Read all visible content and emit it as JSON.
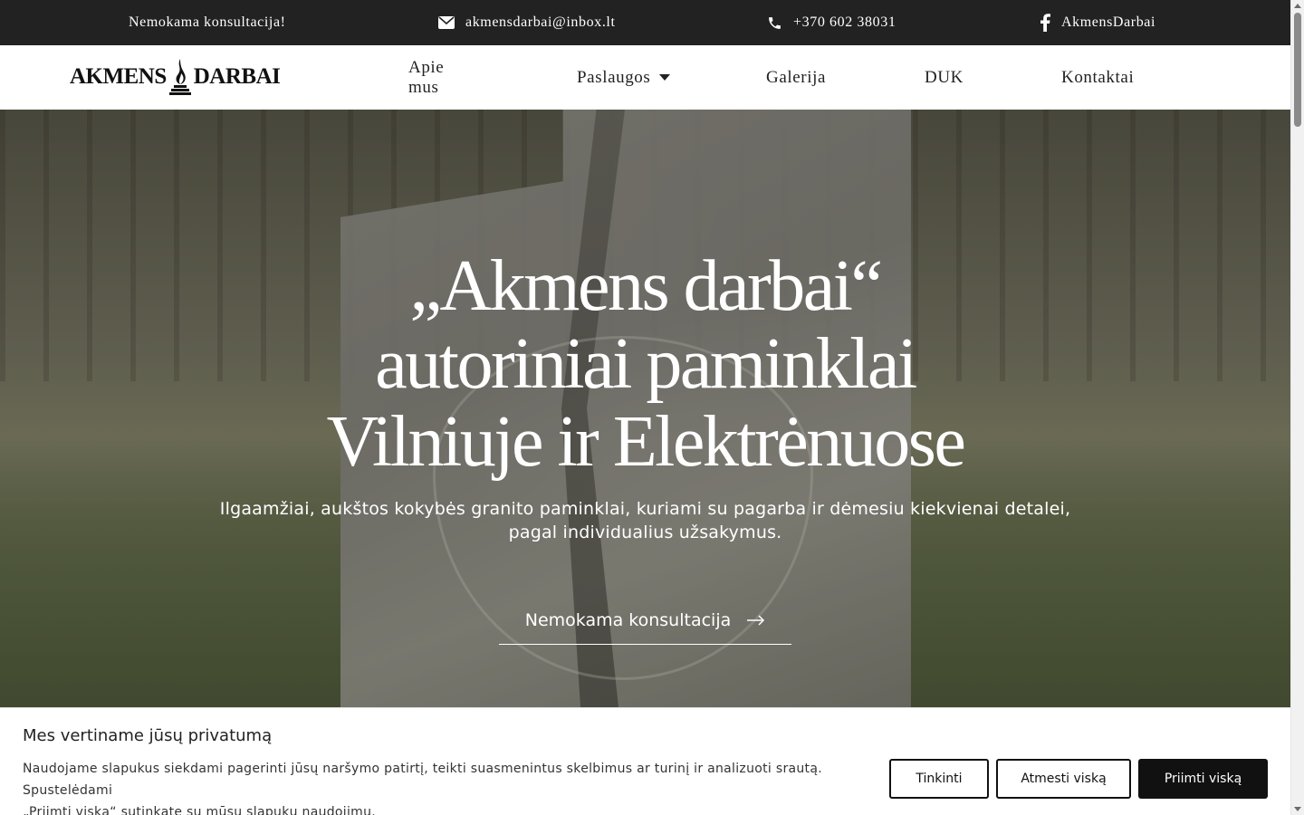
{
  "topbar": {
    "consultation": "Nemokama konsultacija!",
    "email": "akmensdarbai@inbox.lt",
    "phone": "+370 602 38031",
    "facebook": "AkmensDarbai"
  },
  "logo": {
    "left": "AKMENS",
    "right": "DARBAI"
  },
  "nav": {
    "items": [
      {
        "label": "Apie mus"
      },
      {
        "label": "Paslaugos",
        "has_dropdown": true
      },
      {
        "label": "Galerija"
      },
      {
        "label": "DUK"
      },
      {
        "label": "Kontaktai"
      }
    ]
  },
  "hero": {
    "title_line1": "„Akmens darbai“",
    "title_line2": "autoriniai paminklai",
    "title_line3": "Vilniuje ir Elektrėnuose",
    "subtitle_line1": "Ilgaamžiai, aukštos kokybės granito paminklai, kuriami su pagarba ir dėmesiu kiekvienai detalei,",
    "subtitle_line2": "pagal individualius užsakymus.",
    "cta_label": "Nemokama konsultacija"
  },
  "cookie": {
    "title": "Mes vertiname jūsų privatumą",
    "text_line1": "Naudojame slapukus siekdami pagerinti jūsų naršymo patirtį, teikti suasmenintus skelbimus ar turinį ir analizuoti srautą. Spustelėdami",
    "text_line2": "„Priimti viską“ sutinkate su mūsų slapukų naudojimu.",
    "customize_label": "Tinkinti",
    "reject_label": "Atmesti viską",
    "accept_label": "Priimti viską"
  },
  "colors": {
    "topbar_bg": "#222222",
    "text_dark": "#222222",
    "accent_dark": "#111111",
    "white": "#ffffff"
  },
  "icons": [
    "envelope-icon",
    "phone-icon",
    "facebook-icon",
    "flame-logo-icon",
    "caret-down-icon",
    "arrow-right-icon"
  ]
}
